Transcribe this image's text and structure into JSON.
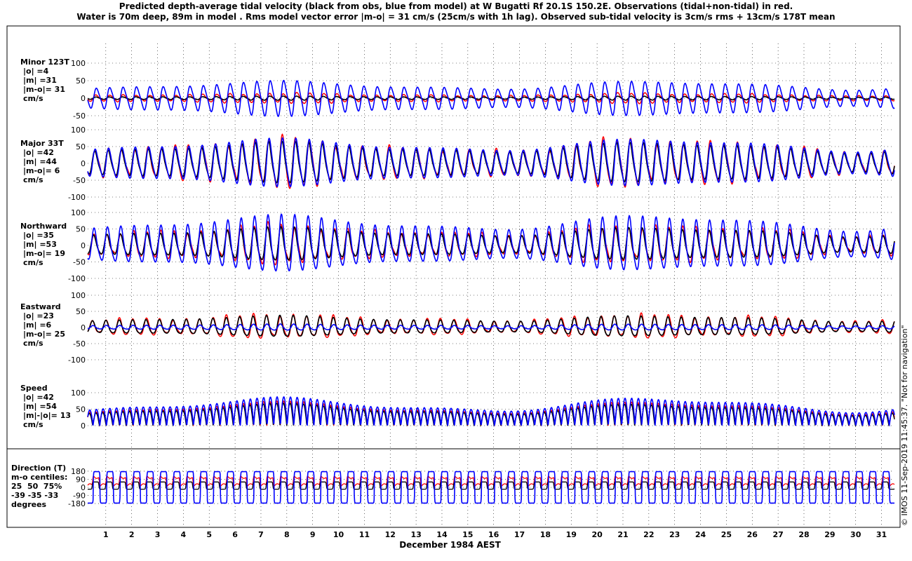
{
  "title_line1": "Predicted depth-average tidal velocity (black from obs, blue from model) at W Bugatti Rf 20.1S 150.2E. Observations (tidal+non-tidal) in red.",
  "title_line2": "Water is 70m deep, 89m in model . Rms model vector error |m-o| = 31 cm/s (25cm/s with 1h lag). Observed sub-tidal velocity is 3cm/s rms + 13cm/s 178T mean",
  "x_axis_label": "December 1984 AEST",
  "copyright": "© IMOS 11-Sep-2019 11:45:37. \"Not for navigation\"",
  "colors": {
    "obs_tidal": "#000000",
    "model": "#0000ff",
    "observations": "#ff0000"
  },
  "panel_labels": [
    [
      "Minor 123T",
      "|o| =4",
      "|m| =31",
      "|m-o|= 31",
      "cm/s"
    ],
    [
      "Major 33T",
      "|o| =42",
      "|m| =44",
      "|m-o|= 6",
      "cm/s"
    ],
    [
      "Northward",
      "|o| =35",
      "|m| =53",
      "|m-o|= 19",
      "cm/s"
    ],
    [
      "Eastward",
      "|o| =23",
      "|m| =6",
      "|m-o|= 25",
      "cm/s"
    ],
    [
      "Speed",
      "|o| =42",
      "|m| =54",
      "|m|-|o|= 13",
      "cm/s"
    ],
    [
      "Direction (T)",
      "m-o centiles:",
      "25  50  75%",
      "-39 -35 -33",
      "degrees"
    ]
  ],
  "chart_data": {
    "type": "line",
    "x": {
      "label": "December 1984 AEST",
      "range_days": [
        0.3,
        31.5
      ],
      "ticks": [
        1,
        2,
        3,
        4,
        5,
        6,
        7,
        8,
        9,
        10,
        11,
        12,
        13,
        14,
        15,
        16,
        17,
        18,
        19,
        20,
        21,
        22,
        23,
        24,
        25,
        26,
        27,
        28,
        29,
        30,
        31
      ]
    },
    "grid": "dotted",
    "series_colors": {
      "black": "tidal prediction from obs",
      "blue": "model",
      "red": "observations (tidal+non-tidal)"
    },
    "panels": [
      {
        "name": "Minor 123T",
        "ylim": [
          -100,
          100
        ],
        "yticks": [
          100,
          50,
          0,
          -50
        ],
        "amplitude": {
          "black": 4,
          "blue": 31,
          "red": 10
        }
      },
      {
        "name": "Major 33T",
        "ylim": [
          -100,
          100
        ],
        "yticks": [
          100,
          50,
          0,
          -50,
          -100
        ],
        "amplitude": {
          "black": 42,
          "blue": 44,
          "red": 48
        }
      },
      {
        "name": "Northward",
        "ylim": [
          -100,
          100
        ],
        "yticks": [
          100,
          50,
          0,
          -50,
          -100
        ],
        "amplitude": {
          "black": 35,
          "blue": 53,
          "red": 40
        }
      },
      {
        "name": "Eastward",
        "ylim": [
          -100,
          100
        ],
        "yticks": [
          100,
          50,
          0,
          -50,
          -100
        ],
        "amplitude": {
          "black": 23,
          "blue": 6,
          "red": 26
        }
      },
      {
        "name": "Speed",
        "ylim": [
          0,
          100
        ],
        "yticks": [
          100,
          50,
          0
        ],
        "mean": {
          "black": 42,
          "blue": 54,
          "red": 46
        }
      },
      {
        "name": "Direction (T)",
        "ylim": [
          -180,
          180
        ],
        "yticks": [
          180,
          90,
          0,
          -90,
          -180
        ]
      }
    ]
  }
}
